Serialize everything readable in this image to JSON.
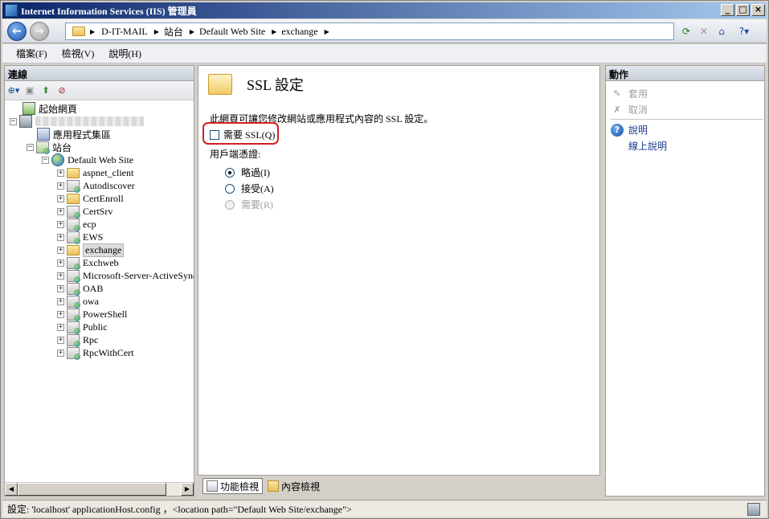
{
  "window": {
    "title": "Internet Information Services (IIS) 管理員",
    "controls": [
      "minimize",
      "maximize",
      "close"
    ]
  },
  "address_bar": {
    "breadcrumbs": [
      "D-IT-MAIL",
      "站台",
      "Default Web Site",
      "exchange"
    ]
  },
  "menu": {
    "items": [
      "檔案(F)",
      "檢視(V)",
      "說明(H)"
    ]
  },
  "connections": {
    "header": "連線",
    "tree": [
      {
        "label": "起始網頁",
        "icon": "start-page-icon"
      },
      {
        "label": "",
        "icon": "server-icon"
      },
      {
        "label": "應用程式集區",
        "icon": "app-pool-icon"
      },
      {
        "label": "站台",
        "icon": "sites-icon"
      },
      {
        "label": "Default Web Site",
        "icon": "globe-icon"
      },
      {
        "label": "aspnet_client",
        "icon": "folder-icon"
      },
      {
        "label": "Autodiscover",
        "icon": "application-icon"
      },
      {
        "label": "CertEnroll",
        "icon": "folder-icon"
      },
      {
        "label": "CertSrv",
        "icon": "application-icon"
      },
      {
        "label": "ecp",
        "icon": "application-icon"
      },
      {
        "label": "EWS",
        "icon": "application-icon"
      },
      {
        "label": "exchange",
        "icon": "folder-icon",
        "selected": true
      },
      {
        "label": "Exchweb",
        "icon": "application-icon"
      },
      {
        "label": "Microsoft-Server-ActiveSync",
        "icon": "application-icon"
      },
      {
        "label": "OAB",
        "icon": "application-icon"
      },
      {
        "label": "owa",
        "icon": "application-icon"
      },
      {
        "label": "PowerShell",
        "icon": "application-icon"
      },
      {
        "label": "Public",
        "icon": "application-icon"
      },
      {
        "label": "Rpc",
        "icon": "application-icon"
      },
      {
        "label": "RpcWithCert",
        "icon": "application-icon"
      }
    ]
  },
  "feature": {
    "title": "SSL 設定",
    "description": "此網頁可讓您修改網站或應用程式內容的 SSL 設定。",
    "require_ssl_label": "需要 SSL(Q)",
    "require_ssl_checked": false,
    "client_certs_label": "用戶端憑證:",
    "client_cert_options": [
      {
        "label": "略過(I)",
        "selected": true,
        "disabled": false
      },
      {
        "label": "接受(A)",
        "selected": false,
        "disabled": false
      },
      {
        "label": "需要(R)",
        "selected": false,
        "disabled": true
      }
    ]
  },
  "view_tabs": {
    "features": "功能檢視",
    "content": "內容檢視"
  },
  "actions": {
    "header": "動作",
    "apply": "套用",
    "cancel": "取消",
    "help": "說明",
    "online_help": "線上說明"
  },
  "status": {
    "text": "設定: 'localhost' applicationHost.config ，<location path=\"Default Web Site/exchange\">"
  }
}
